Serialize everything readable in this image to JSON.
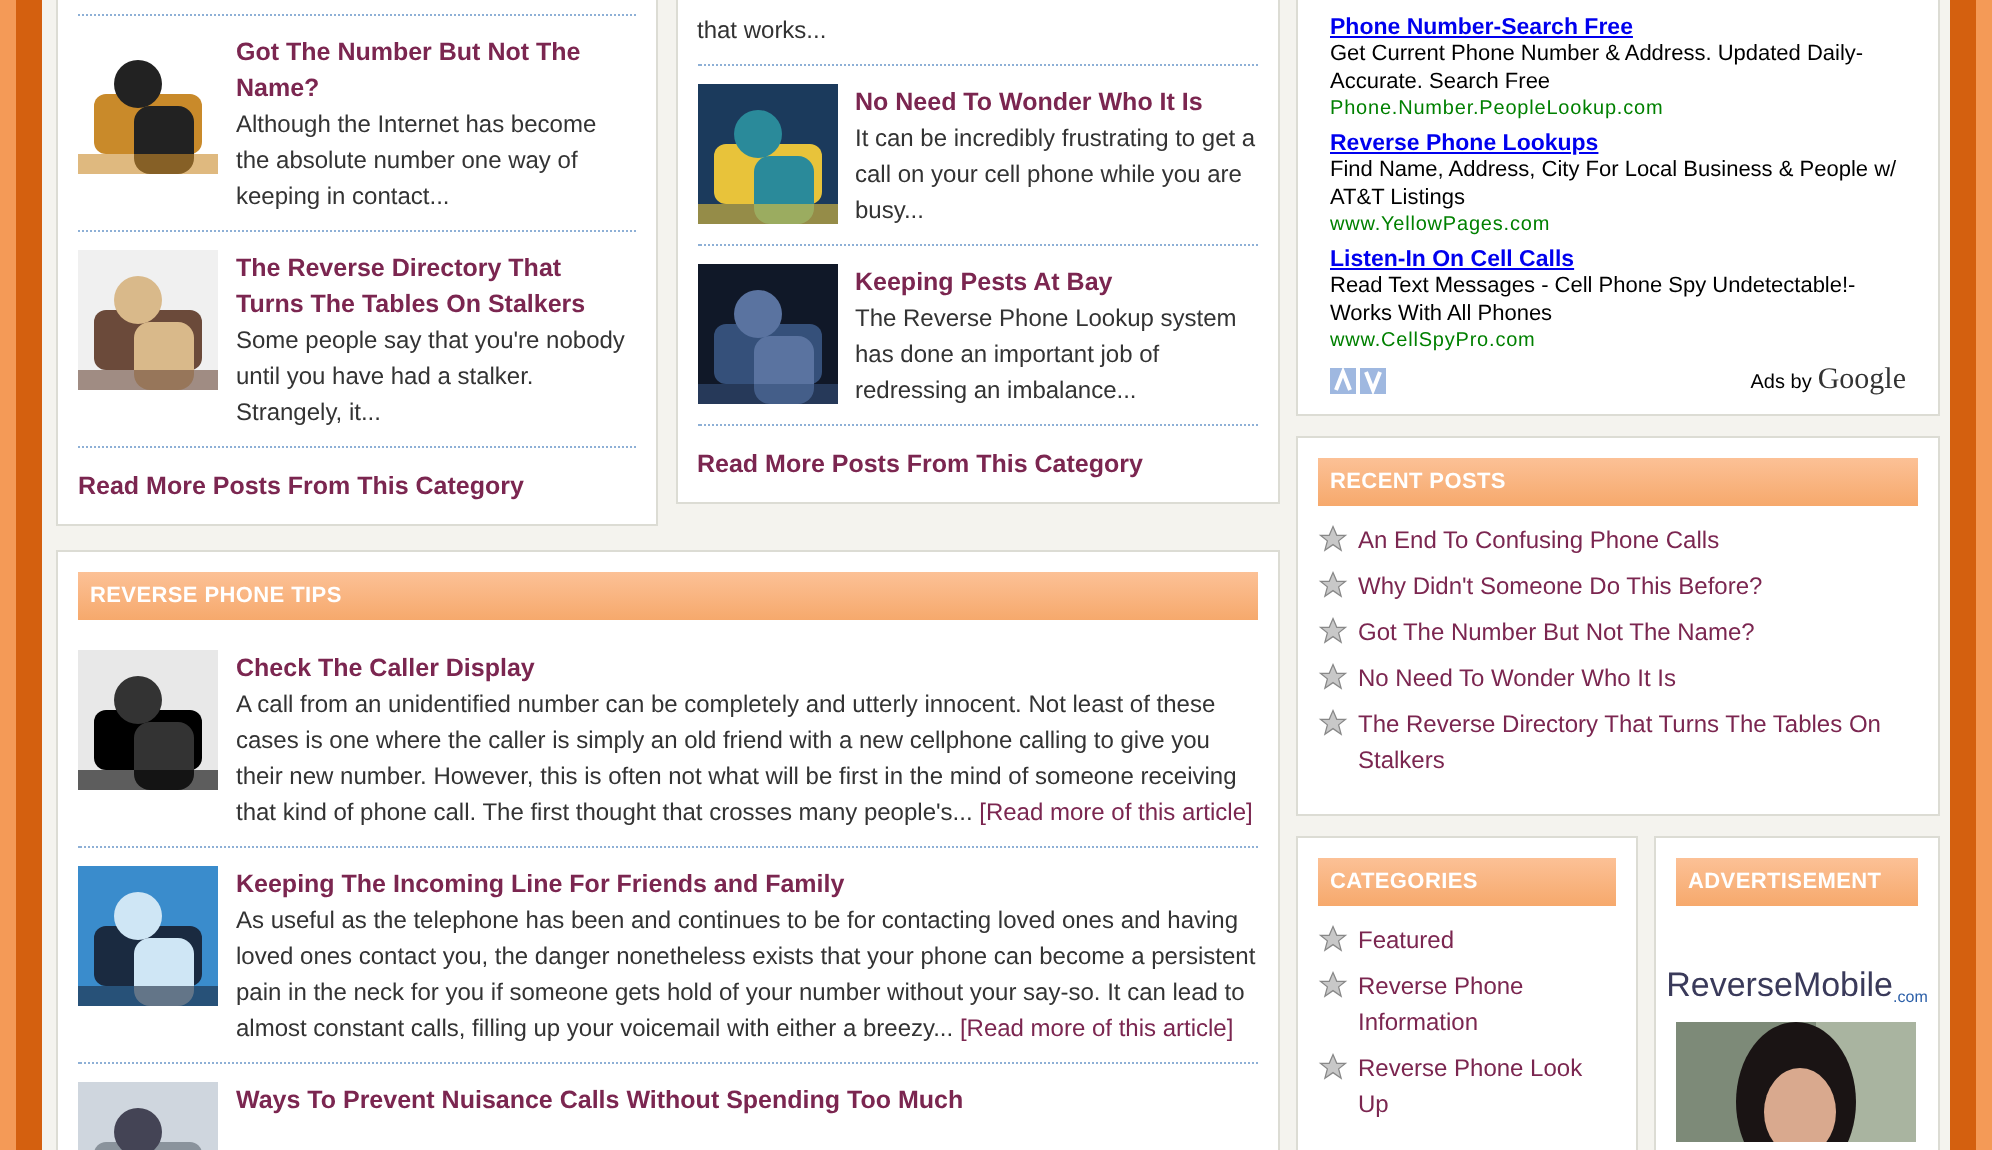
{
  "top_boxes": [
    {
      "posts": [
        {
          "title": "Got The Number But Not The Name?",
          "excerpt": "Although the Internet has become the absolute number one way of keeping in contact..."
        },
        {
          "title": "The Reverse Directory That Turns The Tables On Stalkers",
          "excerpt": "Some people say that you're nobody until you have had a stalker. Strangely, it..."
        }
      ],
      "read_more": "Read More Posts From This Category"
    },
    {
      "lead_text": "that works...",
      "posts": [
        {
          "title": "No Need To Wonder Who It Is",
          "excerpt": "It can be incredibly frustrating to get a call on your cell phone while you are busy..."
        },
        {
          "title": "Keeping Pests At Bay",
          "excerpt": "The Reverse Phone Lookup system has done an important job of redressing an imbalance..."
        }
      ],
      "read_more": "Read More Posts From This Category"
    }
  ],
  "tips": {
    "title": "REVERSE PHONE TIPS",
    "posts": [
      {
        "title": "Check The Caller Display",
        "excerpt": "A call from an unidentified number can be completely and utterly innocent. Not least of these cases is one where the caller is simply an old friend with a new cellphone calling to give you their new number. However, this is often not what will be first in the mind of someone receiving that kind of phone call. The first thought that crosses many people's...",
        "more": "[Read more of this article]"
      },
      {
        "title": "Keeping The Incoming Line For Friends and Family",
        "excerpt": "As useful as the telephone has been and continues to be for contacting loved ones and having loved ones contact you, the danger nonetheless exists that your phone can become a persistent pain in the neck for you if someone gets hold of your number without your say-so. It can lead to almost constant calls, filling up your voicemail with either a breezy...",
        "more": "[Read more of this article]"
      },
      {
        "title": "Ways To Prevent Nuisance Calls Without Spending Too Much"
      }
    ]
  },
  "ads": [
    {
      "title": "Phone Number-Search Free",
      "text": "Get Current Phone Number & Address. Updated Daily-Accurate. Search Free",
      "url": "Phone.Number.PeopleLookup.com"
    },
    {
      "title": "Reverse Phone Lookups",
      "text": "Find Name, Address, City For Local Business & People w/ AT&T Listings",
      "url": "www.YellowPages.com"
    },
    {
      "title": "Listen-In On Cell Calls",
      "text": "Read Text Messages - Cell Phone Spy Undetectable!-Works With All Phones",
      "url": "www.CellSpyPro.com"
    }
  ],
  "ad_footer": {
    "label": "Ads by",
    "brand": "Google"
  },
  "recent_posts": {
    "title": "RECENT POSTS",
    "items": [
      "An End To Confusing Phone Calls",
      "Why Didn't Someone Do This Before?",
      "Got The Number But Not The Name?",
      "No Need To Wonder Who It Is",
      "The Reverse Directory That Turns The Tables On Stalkers"
    ]
  },
  "categories": {
    "title": "CATEGORIES",
    "items": [
      "Featured",
      "Reverse Phone Information",
      "Reverse Phone Look Up"
    ]
  },
  "advertisement": {
    "title": "ADVERTISEMENT",
    "logo": {
      "first": "Reverse",
      "second": "Mobile",
      "suffix": ".com"
    }
  }
}
